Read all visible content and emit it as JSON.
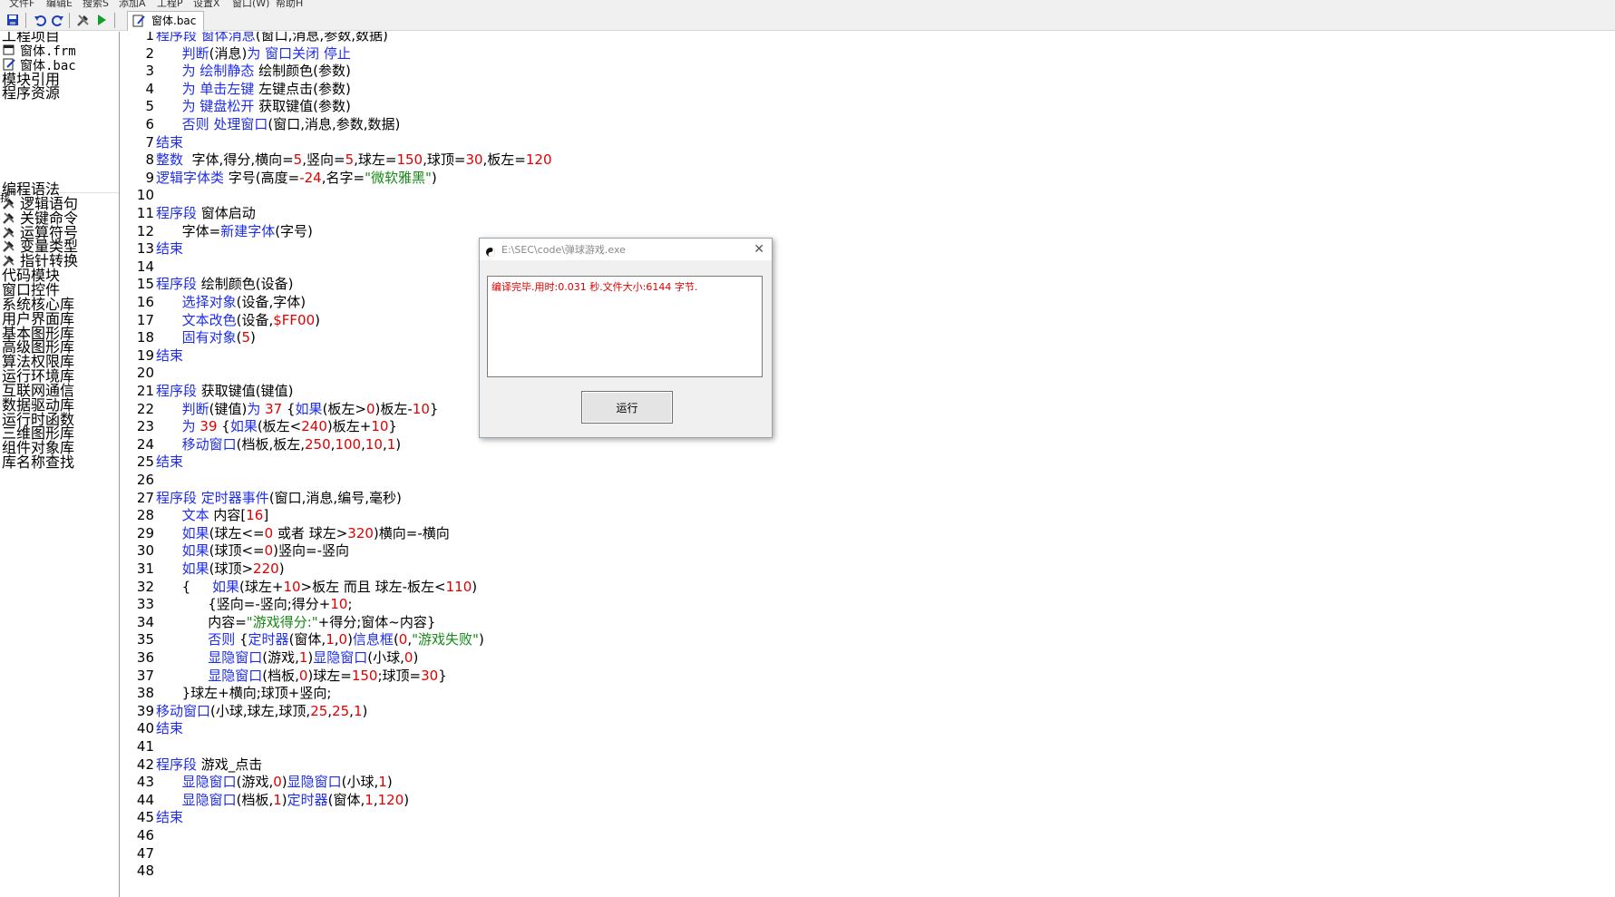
{
  "menubar": [
    {
      "label": "文件F"
    },
    {
      "label": "编辑E"
    },
    {
      "label": "搜索S"
    },
    {
      "label": "添加A"
    },
    {
      "label": "工程P"
    },
    {
      "label": "设置X"
    },
    {
      "label": "窗口(W)"
    },
    {
      "label": "帮助H"
    }
  ],
  "toolbar": {
    "icons": [
      "save-icon",
      "undo-icon",
      "redo-icon",
      "build-icon",
      "run-icon",
      "edit-file-icon"
    ],
    "active_tab": "窗体.bac"
  },
  "sidebar": {
    "project": [
      {
        "label": "工程项目",
        "icon": "none"
      },
      {
        "label": "窗体.frm",
        "icon": "form-file-icon"
      },
      {
        "label": "窗体.bac",
        "icon": "code-file-icon"
      },
      {
        "label": "模块引用",
        "icon": "none"
      },
      {
        "label": "程序资源",
        "icon": "none"
      }
    ],
    "section_label": "找",
    "library": [
      {
        "label": "编程语法",
        "icon": "none"
      },
      {
        "label": "逻辑语句",
        "icon": "tool-icon"
      },
      {
        "label": "关键命令",
        "icon": "tool-icon"
      },
      {
        "label": "运算符号",
        "icon": "tool-icon"
      },
      {
        "label": "变量类型",
        "icon": "tool-icon"
      },
      {
        "label": "指针转换",
        "icon": "tool-icon"
      },
      {
        "label": "代码模块",
        "icon": "none"
      },
      {
        "label": "窗口控件",
        "icon": "none"
      },
      {
        "label": "系统核心库",
        "icon": "none"
      },
      {
        "label": "用户界面库",
        "icon": "none"
      },
      {
        "label": "基本图形库",
        "icon": "none"
      },
      {
        "label": "高级图形库",
        "icon": "none"
      },
      {
        "label": "算法权限库",
        "icon": "none"
      },
      {
        "label": "运行环境库",
        "icon": "none"
      },
      {
        "label": "互联网通信",
        "icon": "none"
      },
      {
        "label": "数据驱动库",
        "icon": "none"
      },
      {
        "label": "运行时函数",
        "icon": "none"
      },
      {
        "label": "三维图形库",
        "icon": "none"
      },
      {
        "label": "组件对象库",
        "icon": "none"
      },
      {
        "label": "库名称查找",
        "icon": "none"
      }
    ]
  },
  "colors": {
    "keyword": "#1f2ee6",
    "number": "#e00000",
    "string": "#178a17",
    "text": "#000000"
  },
  "code_lines": [
    {
      "n": "1",
      "t": [
        [
          "kw",
          "程序段"
        ],
        [
          "tx",
          " "
        ],
        [
          "kw",
          "窗体消息"
        ],
        [
          "tx",
          "(窗口,消息,参数,数据)"
        ]
      ]
    },
    {
      "n": "2",
      "t": [
        [
          "tx",
          "      "
        ],
        [
          "kw",
          "判断"
        ],
        [
          "tx",
          "(消息)"
        ],
        [
          "kw",
          "为 窗口关闭 停止"
        ]
      ]
    },
    {
      "n": "3",
      "t": [
        [
          "tx",
          "      "
        ],
        [
          "kw",
          "为 绘制静态"
        ],
        [
          "tx",
          " 绘制颜色(参数)"
        ]
      ]
    },
    {
      "n": "4",
      "t": [
        [
          "tx",
          "      "
        ],
        [
          "kw",
          "为 单击左键"
        ],
        [
          "tx",
          " 左键点击(参数)"
        ]
      ]
    },
    {
      "n": "5",
      "t": [
        [
          "tx",
          "      "
        ],
        [
          "kw",
          "为 键盘松开"
        ],
        [
          "tx",
          " 获取键值(参数)"
        ]
      ]
    },
    {
      "n": "6",
      "t": [
        [
          "tx",
          "      "
        ],
        [
          "kw",
          "否则 处理窗口"
        ],
        [
          "tx",
          "(窗口,消息,参数,数据)"
        ]
      ]
    },
    {
      "n": "7",
      "t": [
        [
          "kw",
          "结束"
        ]
      ]
    },
    {
      "n": "8",
      "t": [
        [
          "kw",
          "整数"
        ],
        [
          "tx",
          "  字体,得分,横向="
        ],
        [
          "num",
          "5"
        ],
        [
          "tx",
          ",竖向="
        ],
        [
          "num",
          "5"
        ],
        [
          "tx",
          ",球左="
        ],
        [
          "num",
          "150"
        ],
        [
          "tx",
          ",球顶="
        ],
        [
          "num",
          "30"
        ],
        [
          "tx",
          ",板左="
        ],
        [
          "num",
          "120"
        ]
      ]
    },
    {
      "n": "9",
      "t": [
        [
          "kw",
          "逻辑字体类"
        ],
        [
          "tx",
          " 字号(高度="
        ],
        [
          "num",
          "-24"
        ],
        [
          "tx",
          ",名字="
        ],
        [
          "str",
          "\"微软雅黑\""
        ],
        [
          "tx",
          ")"
        ]
      ]
    },
    {
      "n": "10",
      "t": []
    },
    {
      "n": "11",
      "t": [
        [
          "kw",
          "程序段"
        ],
        [
          "tx",
          " 窗体启动"
        ]
      ]
    },
    {
      "n": "12",
      "t": [
        [
          "tx",
          "      字体="
        ],
        [
          "kw",
          "新建字体"
        ],
        [
          "tx",
          "(字号)"
        ]
      ]
    },
    {
      "n": "13",
      "t": [
        [
          "kw",
          "结束"
        ]
      ]
    },
    {
      "n": "14",
      "t": []
    },
    {
      "n": "15",
      "t": [
        [
          "kw",
          "程序段"
        ],
        [
          "tx",
          " 绘制颜色(设备)"
        ]
      ]
    },
    {
      "n": "16",
      "t": [
        [
          "tx",
          "      "
        ],
        [
          "kw",
          "选择对象"
        ],
        [
          "tx",
          "(设备,字体)"
        ]
      ]
    },
    {
      "n": "17",
      "t": [
        [
          "tx",
          "      "
        ],
        [
          "kw",
          "文本改色"
        ],
        [
          "tx",
          "(设备,"
        ],
        [
          "num",
          "$FF00"
        ],
        [
          "tx",
          ")"
        ]
      ]
    },
    {
      "n": "18",
      "t": [
        [
          "tx",
          "      "
        ],
        [
          "kw",
          "固有对象"
        ],
        [
          "tx",
          "("
        ],
        [
          "num",
          "5"
        ],
        [
          "tx",
          ")"
        ]
      ]
    },
    {
      "n": "19",
      "t": [
        [
          "kw",
          "结束"
        ]
      ]
    },
    {
      "n": "20",
      "t": []
    },
    {
      "n": "21",
      "t": [
        [
          "kw",
          "程序段"
        ],
        [
          "tx",
          " 获取键值(键值)"
        ]
      ]
    },
    {
      "n": "22",
      "t": [
        [
          "tx",
          "      "
        ],
        [
          "kw",
          "判断"
        ],
        [
          "tx",
          "(键值)"
        ],
        [
          "kw",
          "为"
        ],
        [
          "tx",
          " "
        ],
        [
          "num",
          "37"
        ],
        [
          "tx",
          " {"
        ],
        [
          "kw",
          "如果"
        ],
        [
          "tx",
          "(板左>"
        ],
        [
          "num",
          "0"
        ],
        [
          "tx",
          ")板左-"
        ],
        [
          "num",
          "10"
        ],
        [
          "tx",
          "}"
        ]
      ]
    },
    {
      "n": "23",
      "t": [
        [
          "tx",
          "      "
        ],
        [
          "kw",
          "为"
        ],
        [
          "tx",
          " "
        ],
        [
          "num",
          "39"
        ],
        [
          "tx",
          " {"
        ],
        [
          "kw",
          "如果"
        ],
        [
          "tx",
          "(板左<"
        ],
        [
          "num",
          "240"
        ],
        [
          "tx",
          ")板左+"
        ],
        [
          "num",
          "10"
        ],
        [
          "tx",
          "}"
        ]
      ]
    },
    {
      "n": "24",
      "t": [
        [
          "tx",
          "      "
        ],
        [
          "kw",
          "移动窗口"
        ],
        [
          "tx",
          "(档板,板左,"
        ],
        [
          "num",
          "250"
        ],
        [
          "tx",
          ","
        ],
        [
          "num",
          "100"
        ],
        [
          "tx",
          ","
        ],
        [
          "num",
          "10"
        ],
        [
          "tx",
          ","
        ],
        [
          "num",
          "1"
        ],
        [
          "tx",
          ")"
        ]
      ]
    },
    {
      "n": "25",
      "t": [
        [
          "kw",
          "结束"
        ]
      ]
    },
    {
      "n": "26",
      "t": []
    },
    {
      "n": "27",
      "t": [
        [
          "kw",
          "程序段"
        ],
        [
          "tx",
          " "
        ],
        [
          "kw",
          "定时器事件"
        ],
        [
          "tx",
          "(窗口,消息,编号,毫秒)"
        ]
      ]
    },
    {
      "n": "28",
      "t": [
        [
          "tx",
          "      "
        ],
        [
          "kw",
          "文本"
        ],
        [
          "tx",
          " 内容["
        ],
        [
          "num",
          "16"
        ],
        [
          "tx",
          "]"
        ]
      ]
    },
    {
      "n": "29",
      "t": [
        [
          "tx",
          "      "
        ],
        [
          "kw",
          "如果"
        ],
        [
          "tx",
          "(球左<="
        ],
        [
          "num",
          "0"
        ],
        [
          "tx",
          " 或者 球左>"
        ],
        [
          "num",
          "320"
        ],
        [
          "tx",
          ")横向=-横向"
        ]
      ]
    },
    {
      "n": "30",
      "t": [
        [
          "tx",
          "      "
        ],
        [
          "kw",
          "如果"
        ],
        [
          "tx",
          "(球顶<="
        ],
        [
          "num",
          "0"
        ],
        [
          "tx",
          ")竖向=-竖向"
        ]
      ]
    },
    {
      "n": "31",
      "t": [
        [
          "tx",
          "      "
        ],
        [
          "kw",
          "如果"
        ],
        [
          "tx",
          "(球顶>"
        ],
        [
          "num",
          "220"
        ],
        [
          "tx",
          ")"
        ]
      ]
    },
    {
      "n": "32",
      "t": [
        [
          "tx",
          "      {     "
        ],
        [
          "kw",
          "如果"
        ],
        [
          "tx",
          "(球左+"
        ],
        [
          "num",
          "10"
        ],
        [
          "tx",
          ">板左 而且 球左-板左<"
        ],
        [
          "num",
          "110"
        ],
        [
          "tx",
          ")"
        ]
      ]
    },
    {
      "n": "33",
      "t": [
        [
          "tx",
          "            {竖向=-竖向;得分+"
        ],
        [
          "num",
          "10"
        ],
        [
          "tx",
          ";"
        ]
      ]
    },
    {
      "n": "34",
      "t": [
        [
          "tx",
          "            内容="
        ],
        [
          "str",
          "\"游戏得分:\""
        ],
        [
          "tx",
          "+得分;窗体~内容}"
        ]
      ]
    },
    {
      "n": "35",
      "t": [
        [
          "tx",
          "            "
        ],
        [
          "kw",
          "否则"
        ],
        [
          "tx",
          " {"
        ],
        [
          "kw",
          "定时器"
        ],
        [
          "tx",
          "(窗体,"
        ],
        [
          "num",
          "1"
        ],
        [
          "tx",
          ","
        ],
        [
          "num",
          "0"
        ],
        [
          "tx",
          ")"
        ],
        [
          "kw",
          "信息框"
        ],
        [
          "tx",
          "("
        ],
        [
          "num",
          "0"
        ],
        [
          "tx",
          ","
        ],
        [
          "str",
          "\"游戏失败\""
        ],
        [
          "tx",
          ")"
        ]
      ]
    },
    {
      "n": "36",
      "t": [
        [
          "tx",
          "            "
        ],
        [
          "kw",
          "显隐窗口"
        ],
        [
          "tx",
          "(游戏,"
        ],
        [
          "num",
          "1"
        ],
        [
          "tx",
          ")"
        ],
        [
          "kw",
          "显隐窗口"
        ],
        [
          "tx",
          "(小球,"
        ],
        [
          "num",
          "0"
        ],
        [
          "tx",
          ")"
        ]
      ]
    },
    {
      "n": "37",
      "t": [
        [
          "tx",
          "            "
        ],
        [
          "kw",
          "显隐窗口"
        ],
        [
          "tx",
          "(档板,"
        ],
        [
          "num",
          "0"
        ],
        [
          "tx",
          ")球左="
        ],
        [
          "num",
          "150"
        ],
        [
          "tx",
          ";球顶="
        ],
        [
          "num",
          "30"
        ],
        [
          "tx",
          "}"
        ]
      ]
    },
    {
      "n": "38",
      "t": [
        [
          "tx",
          "      }球左+横向;球顶+竖向;"
        ]
      ]
    },
    {
      "n": "39",
      "t": [
        [
          "kw",
          "移动窗口"
        ],
        [
          "tx",
          "(小球,球左,球顶,"
        ],
        [
          "num",
          "25"
        ],
        [
          "tx",
          ","
        ],
        [
          "num",
          "25"
        ],
        [
          "tx",
          ","
        ],
        [
          "num",
          "1"
        ],
        [
          "tx",
          ")"
        ]
      ]
    },
    {
      "n": "40",
      "t": [
        [
          "kw",
          "结束"
        ]
      ]
    },
    {
      "n": "41",
      "t": []
    },
    {
      "n": "42",
      "t": [
        [
          "kw",
          "程序段"
        ],
        [
          "tx",
          " 游戏_点击"
        ]
      ]
    },
    {
      "n": "43",
      "t": [
        [
          "tx",
          "      "
        ],
        [
          "kw",
          "显隐窗口"
        ],
        [
          "tx",
          "(游戏,"
        ],
        [
          "num",
          "0"
        ],
        [
          "tx",
          ")"
        ],
        [
          "kw",
          "显隐窗口"
        ],
        [
          "tx",
          "(小球,"
        ],
        [
          "num",
          "1"
        ],
        [
          "tx",
          ")"
        ]
      ]
    },
    {
      "n": "44",
      "t": [
        [
          "tx",
          "      "
        ],
        [
          "kw",
          "显隐窗口"
        ],
        [
          "tx",
          "(档板,"
        ],
        [
          "num",
          "1"
        ],
        [
          "tx",
          ")"
        ],
        [
          "kw",
          "定时器"
        ],
        [
          "tx",
          "(窗体,"
        ],
        [
          "num",
          "1"
        ],
        [
          "tx",
          ","
        ],
        [
          "num",
          "120"
        ],
        [
          "tx",
          ")"
        ]
      ]
    },
    {
      "n": "45",
      "t": [
        [
          "kw",
          "结束"
        ]
      ]
    },
    {
      "n": "46",
      "t": []
    },
    {
      "n": "47",
      "t": []
    },
    {
      "n": "48",
      "t": []
    }
  ],
  "dialog": {
    "title": "E:\\SEC\\code\\弹球游戏.exe",
    "output": "编译完毕.用时:0.031 秒.文件大小:6144 字节.",
    "run_label": "运行",
    "close_glyph": "✕"
  }
}
